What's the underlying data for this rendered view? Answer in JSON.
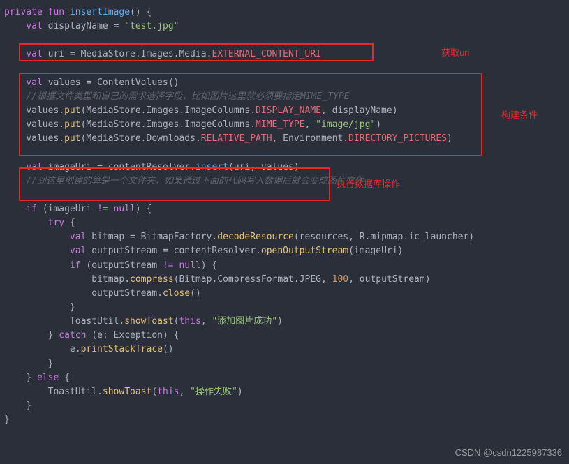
{
  "code": {
    "l1_private": "private",
    "l1_fun": "fun",
    "l1_name": "insertImage",
    "l1_parens": "() {",
    "l2_val": "val",
    "l2_id": "displayName",
    "l2_eq": " = ",
    "l2_str": "\"test.jpg\"",
    "l4_val": "val",
    "l4_id": "uri",
    "l4_rhs_a": " = MediaStore.Images.Media.",
    "l4_const": "EXTERNAL_CONTENT_URI",
    "l6_val": "val",
    "l6_id": "values",
    "l6_rhs": " = ContentValues()",
    "l7_comment": "//根据文件类型和自己的需求选择字段，比如图片这里就必须要指定MIME_TYPE",
    "l8_a": "values.",
    "l8_put": "put",
    "l8_b": "(MediaStore.Images.ImageColumns.",
    "l8_const": "DISPLAY_NAME",
    "l8_c": ", displayName)",
    "l9_a": "values.",
    "l9_put": "put",
    "l9_b": "(MediaStore.Images.ImageColumns.",
    "l9_const": "MIME_TYPE",
    "l9_c": ", ",
    "l9_str": "\"image/jpg\"",
    "l9_d": ")",
    "l10_a": "values.",
    "l10_put": "put",
    "l10_b": "(MediaStore.Downloads.",
    "l10_const": "RELATIVE_PATH",
    "l10_c": ", Environment.",
    "l10_const2": "DIRECTORY_PICTURES",
    "l10_d": ")",
    "l12_val": "val",
    "l12_id": "imageUri",
    "l12_a": " = contentResolver.",
    "l12_insert": "insert",
    "l12_b": "(uri, values)",
    "l13_comment": "//到这里创建的算是一个文件夹，如果通过下面的代码写入数据后就会变成图片文件",
    "l15_if": "if",
    "l15_a": " (imageUri ",
    "l15_op": "!=",
    "l15_b": " ",
    "l15_null": "null",
    "l15_c": ") {",
    "l16_try": "try",
    "l16_b": " {",
    "l17_val": "val",
    "l17_id": "bitmap",
    "l17_a": " = BitmapFactory.",
    "l17_m": "decodeResource",
    "l17_b": "(resources, R.mipmap.ic_launcher)",
    "l18_val": "val",
    "l18_id": "outputStream",
    "l18_a": " = contentResolver.",
    "l18_m": "openOutputStream",
    "l18_b": "(imageUri)",
    "l19_if": "if",
    "l19_a": " (outputStream ",
    "l19_op": "!=",
    "l19_b": " ",
    "l19_null": "null",
    "l19_c": ") {",
    "l20_a": "bitmap.",
    "l20_m": "compress",
    "l20_b": "(Bitmap.CompressFormat.JPEG, ",
    "l20_num": "100",
    "l20_c": ", outputStream)",
    "l21_a": "outputStream.",
    "l21_m": "close",
    "l21_b": "()",
    "l22_brace": "}",
    "l23_a": "ToastUtil.",
    "l23_m": "showToast",
    "l23_b": "(",
    "l23_this": "this",
    "l23_c": ", ",
    "l23_str": "\"添加图片成功\"",
    "l23_d": ")",
    "l24_brace": "}",
    "l24_catch": "catch",
    "l24_b": " (e: Exception) {",
    "l25_a": "e.",
    "l25_m": "printStackTrace",
    "l25_b": "()",
    "l26_brace": "}",
    "l27_brace": "}",
    "l27_else": "else",
    "l27_b": " {",
    "l28_a": "ToastUtil.",
    "l28_m": "showToast",
    "l28_b": "(",
    "l28_this": "this",
    "l28_c": ", ",
    "l28_str": "\"操作失败\"",
    "l28_d": ")",
    "l29_brace": "}",
    "l30_brace": "}"
  },
  "annotations": {
    "label1": "获取uri",
    "label2": "构建条件",
    "label3": "执行数据库操作"
  },
  "watermark": "CSDN @csdn1225987336"
}
